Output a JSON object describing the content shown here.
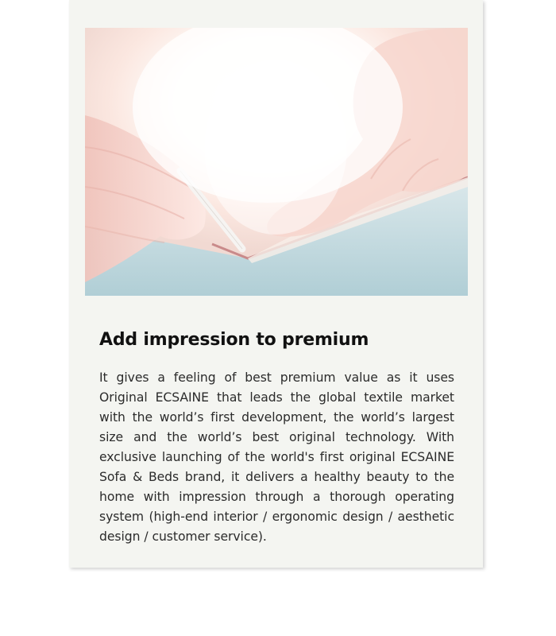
{
  "card": {
    "title": "Add impression to premium",
    "body": "It gives a feeling of best premium value as it uses Original ECSAINE that leads the global textile market with the world’s first development, the world’s largest size and the world’s best original technology.  With exclusive launching of the world's first original ECSAINE Sofa & Beds brand, it delivers a healthy beauty to the home with impression through a thorough operating system (high-end interior / ergonomic design / aesthetic design / customer service)."
  },
  "colors": {
    "card_background": "#f4f5f1",
    "title": "#111111",
    "body_text": "#2b2b2b"
  }
}
